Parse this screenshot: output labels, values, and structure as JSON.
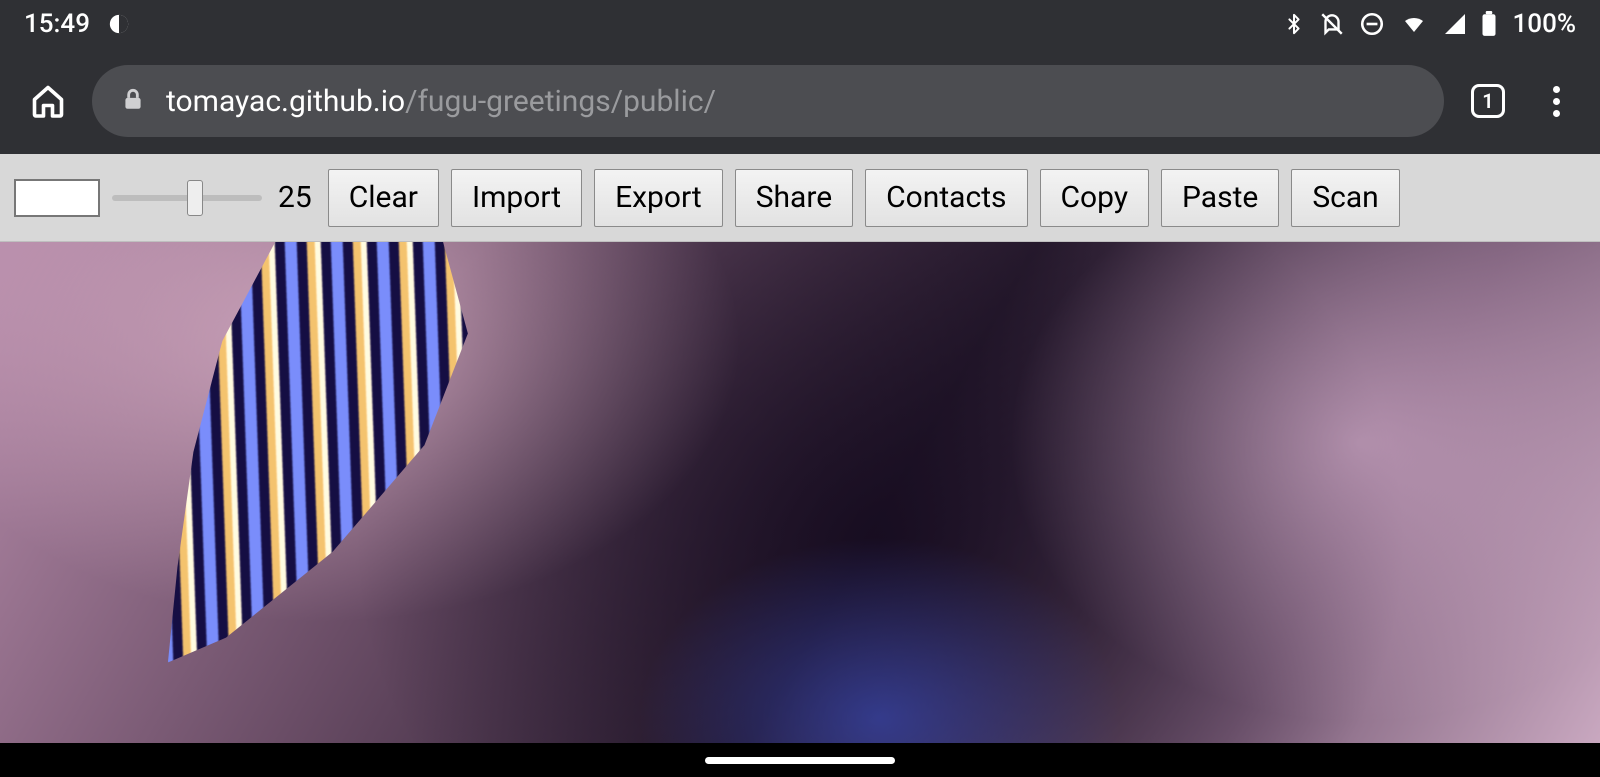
{
  "status": {
    "time": "15:49",
    "battery_percent": "100%"
  },
  "chrome": {
    "url_host": "tomayac.github.io",
    "url_path": "/fugu-greetings/public/",
    "tab_count": "1"
  },
  "toolbar": {
    "slider_value": "25",
    "buttons": {
      "clear": "Clear",
      "import": "Import",
      "export": "Export",
      "share": "Share",
      "contacts": "Contacts",
      "copy": "Copy",
      "paste": "Paste",
      "scan": "Scan"
    }
  }
}
